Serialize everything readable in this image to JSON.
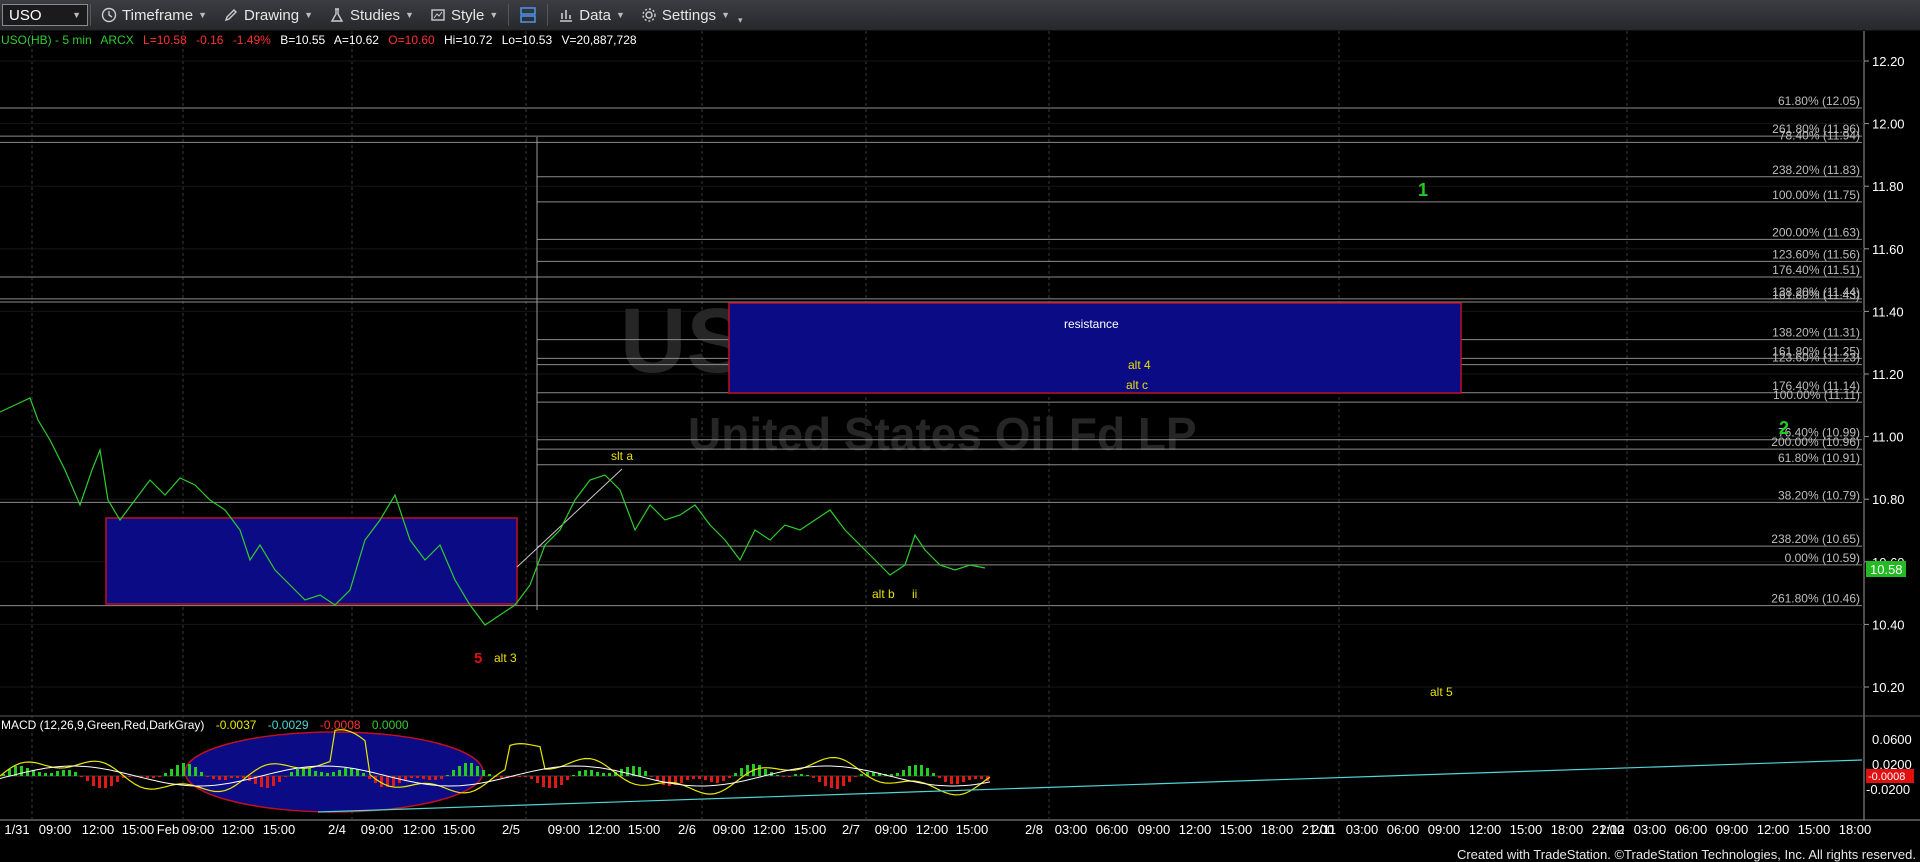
{
  "toolbar": {
    "symbol": "USO",
    "timeframe_label": "Timeframe",
    "drawing_label": "Drawing",
    "studies_label": "Studies",
    "style_label": "Style",
    "data_label": "Data",
    "settings_label": "Settings"
  },
  "header": {
    "symbol_info": "USO(HB) - 5 min",
    "exchange": "ARCX",
    "last": "L=10.58",
    "change": "-0.16",
    "change_pct": "-1.49%",
    "bid": "B=10.55",
    "ask": "A=10.62",
    "open": "O=10.60",
    "high": "Hi=10.72",
    "low": "Lo=10.53",
    "volume": "V=20,887,728"
  },
  "watermark": {
    "symbol": "USO",
    "name": "United States Oil Fd LP"
  },
  "colors": {
    "price_up": "#2ecc2e",
    "label_yellow": "#e8e000",
    "box_fill": "#0a0a8a",
    "box_border": "#c01020",
    "macd_line": "#e8e800",
    "signal_line": "#ffffff",
    "trend_line": "#4fd6d6",
    "last_price_bg": "#22bb22"
  },
  "chart_data": {
    "type": "line",
    "title": "USO(HB) - 5 min",
    "ylim": [
      10.15,
      12.28
    ],
    "y_ticks": [
      "12.20",
      "12.00",
      "11.80",
      "11.60",
      "11.40",
      "11.20",
      "11.00",
      "10.80",
      "10.60",
      "10.40",
      "10.20"
    ],
    "x_tick_labels": [
      "1/31",
      "09:00",
      "12:00",
      "15:00",
      "Feb",
      "09:00",
      "12:00",
      "15:00",
      "2/4",
      "09:00",
      "12:00",
      "15:00",
      "2/5",
      "09:00",
      "12:00",
      "15:00",
      "2/6",
      "09:00",
      "12:00",
      "15:00",
      "2/7",
      "09:00",
      "12:00",
      "15:00",
      "2/8",
      "03:00",
      "06:00",
      "09:00",
      "12:00",
      "15:00",
      "18:00",
      "21:00",
      "2/11",
      "03:00",
      "06:00",
      "09:00",
      "12:00",
      "15:00",
      "18:00",
      "21:00",
      "2/12",
      "03:00",
      "06:00",
      "09:00",
      "12:00",
      "15:00",
      "18:00"
    ],
    "last_price": "10.58",
    "fib_levels": [
      {
        "label": "61.80% (12.05)",
        "value": 12.05
      },
      {
        "label": "261.80% (11.96)",
        "value": 11.96
      },
      {
        "label": "78.40% (11.94)",
        "value": 11.94
      },
      {
        "label": "238.20% (11.83)",
        "value": 11.83
      },
      {
        "label": "100.00% (11.75)",
        "value": 11.75
      },
      {
        "label": "200.00% (11.63)",
        "value": 11.63
      },
      {
        "label": "123.60% (11.56)",
        "value": 11.56
      },
      {
        "label": "176.40% (11.51)",
        "value": 11.51
      },
      {
        "label": "138.20% (11.44)",
        "value": 11.44
      },
      {
        "label": "161.80% (11.43)",
        "value": 11.43
      },
      {
        "label": "138.20% (11.31)",
        "value": 11.31
      },
      {
        "label": "161.80% (11.25)",
        "value": 11.25
      },
      {
        "label": "123.60% (11.23)",
        "value": 11.23
      },
      {
        "label": "176.40% (11.14)",
        "value": 11.14
      },
      {
        "label": "100.00% (11.11)",
        "value": 11.11
      },
      {
        "label": "76.40% (10.99)",
        "value": 10.99
      },
      {
        "label": "200.00% (10.96)",
        "value": 10.96
      },
      {
        "label": "61.80% (10.91)",
        "value": 10.91
      },
      {
        "label": "38.20% (10.79)",
        "value": 10.79
      },
      {
        "label": "238.20% (10.65)",
        "value": 10.65
      },
      {
        "label": "0.00% (10.59)",
        "value": 10.59
      },
      {
        "label": "261.80% (10.46)",
        "value": 10.46
      }
    ],
    "annotations": [
      {
        "text": "resistance",
        "color": "#ffffff"
      },
      {
        "text": "alt 4",
        "color": "#e8e000"
      },
      {
        "text": "alt c",
        "color": "#e8e000"
      },
      {
        "text": "slt a",
        "color": "#e8e000"
      },
      {
        "text": "alt b",
        "color": "#e8e000"
      },
      {
        "text": "ii",
        "color": "#e8e000"
      },
      {
        "text": "5",
        "color": "#e01010"
      },
      {
        "text": "alt 3",
        "color": "#e8e000"
      },
      {
        "text": "alt 5",
        "color": "#e8e000"
      },
      {
        "text": "1",
        "color": "#22cc22"
      },
      {
        "text": "2",
        "color": "#22cc22"
      }
    ],
    "boxes": [
      {
        "name": "resistance-zone",
        "y_top": 11.43,
        "y_bottom": 11.14
      },
      {
        "name": "support-zone",
        "y_top": 10.74,
        "y_bottom": 10.47
      }
    ]
  },
  "macd": {
    "label": "MACD (12,26,9,Green,Red,DarkGray)",
    "macd_value": "-0.0037",
    "signal_value": "-0.0029",
    "hist_value": "-0.0008",
    "zero_value": "0.0000",
    "y_ticks": [
      "0.0600",
      "0.0200",
      "-0.0200"
    ],
    "current_value": "-0.0008"
  },
  "footer": {
    "credit": "Created with TradeStation. ©TradeStation Technologies, Inc. All rights reserved."
  }
}
